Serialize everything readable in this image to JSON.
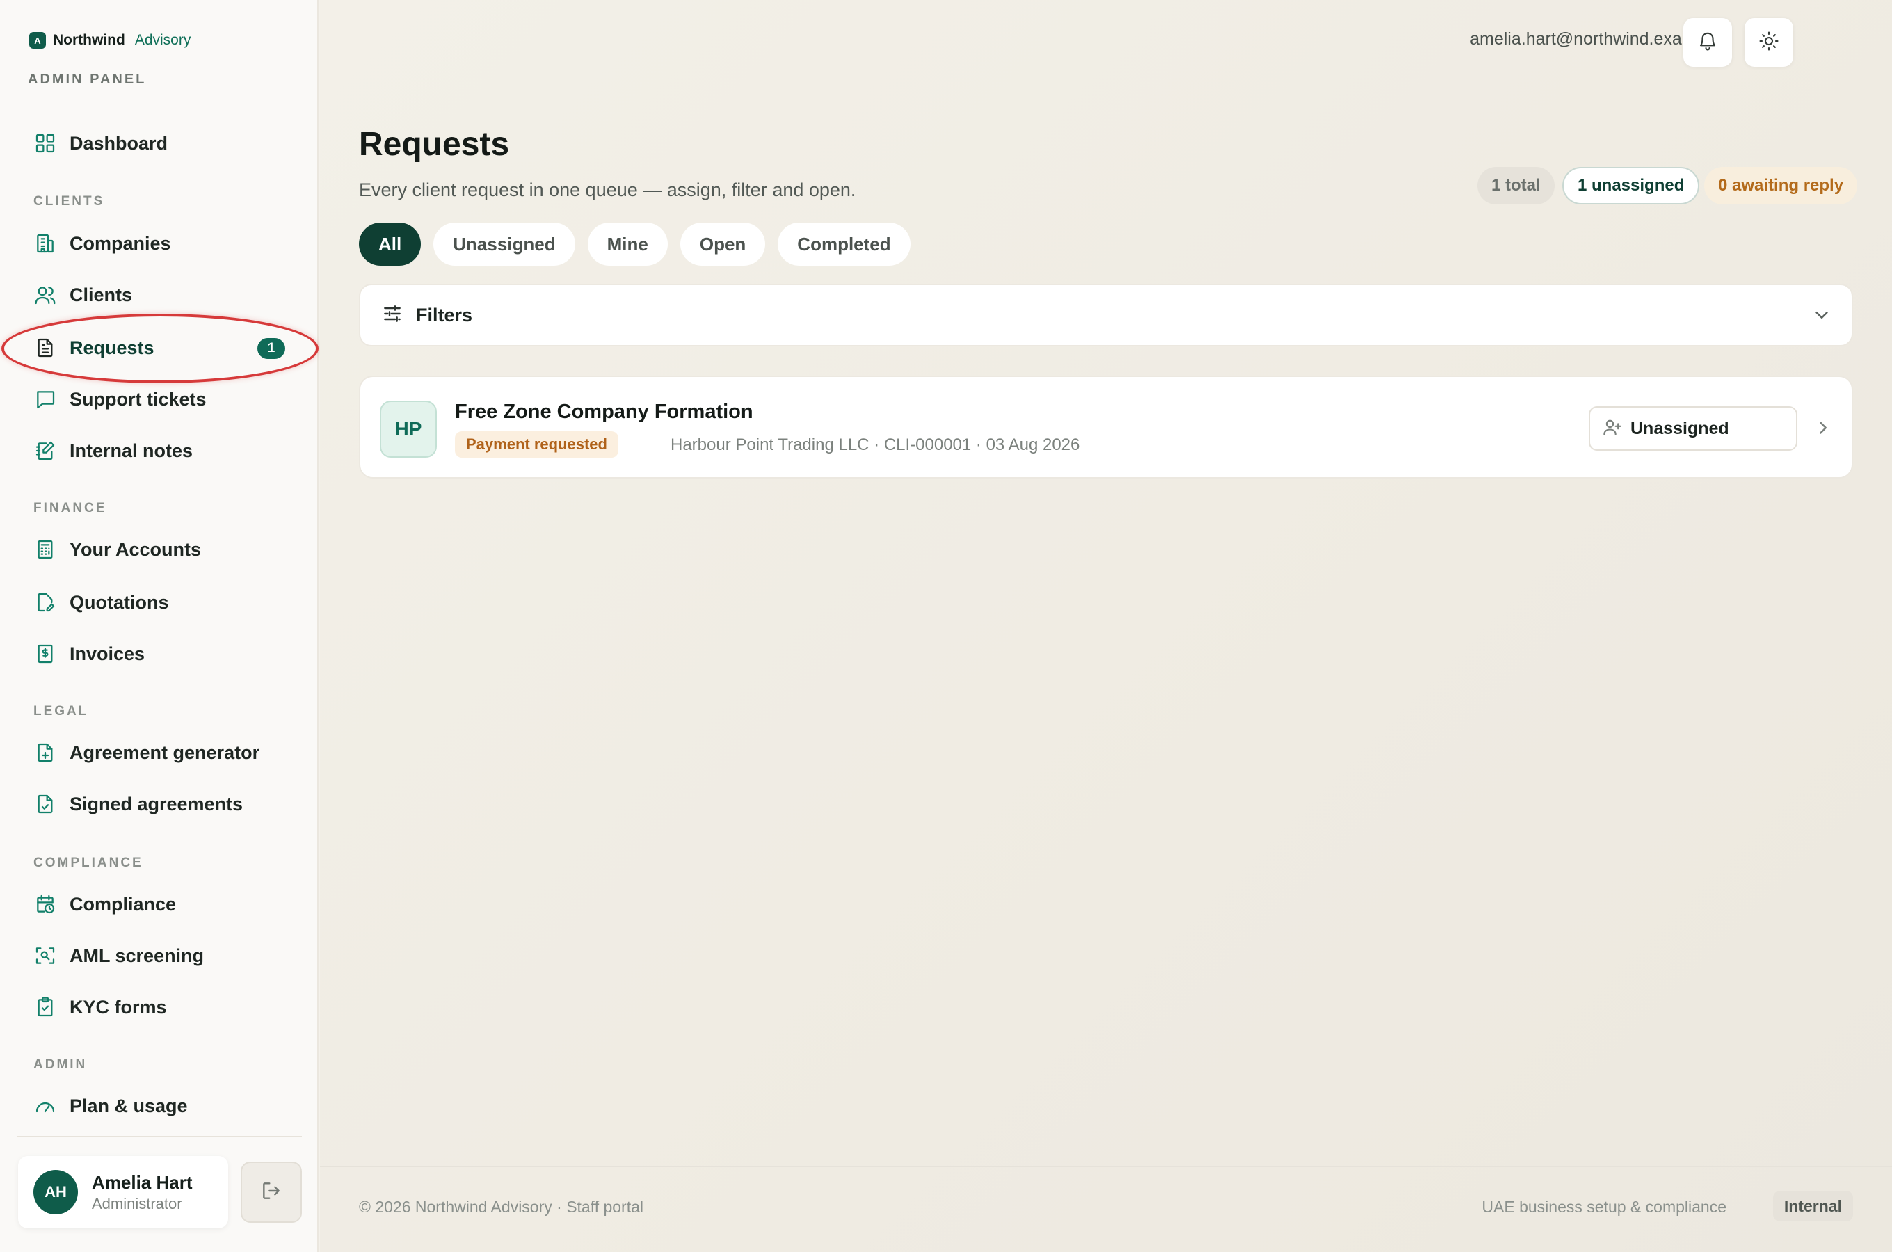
{
  "brand": {
    "logo_letter": "A",
    "name": "Northwind",
    "sub": "Advisory"
  },
  "panel_label": "ADMIN PANEL",
  "nav": {
    "dashboard": "Dashboard",
    "sections": {
      "clients": "CLIENTS",
      "finance": "FINANCE",
      "legal": "LEGAL",
      "compliance": "COMPLIANCE",
      "admin": "ADMIN"
    },
    "items": {
      "companies": "Companies",
      "clients": "Clients",
      "requests": "Requests",
      "requests_badge": "1",
      "support_tickets": "Support tickets",
      "internal_notes": "Internal notes",
      "your_accounts": "Your Accounts",
      "quotations": "Quotations",
      "invoices": "Invoices",
      "agreement_generator": "Agreement generator",
      "signed_agreements": "Signed agreements",
      "compliance": "Compliance",
      "aml_screening": "AML screening",
      "kyc_forms": "KYC forms",
      "plan_usage": "Plan & usage"
    }
  },
  "user": {
    "initials": "AH",
    "name": "Amelia Hart",
    "role": "Administrator"
  },
  "topbar": {
    "email": "amelia.hart@northwind.example"
  },
  "page": {
    "title": "Requests",
    "subtitle": "Every client request in one queue — assign, filter and open."
  },
  "stats": {
    "total": "1 total",
    "unassigned": "1 unassigned",
    "awaiting": "0 awaiting reply"
  },
  "tabs": [
    "All",
    "Unassigned",
    "Mine",
    "Open",
    "Completed"
  ],
  "filters": {
    "label": "Filters"
  },
  "requests": [
    {
      "initials": "HP",
      "title": "Free Zone Company Formation",
      "status": "Payment requested",
      "meta": "Harbour Point Trading LLC · CLI-000001 · 03 Aug 2026",
      "assignee": "Unassigned"
    }
  ],
  "footer": {
    "copyright": "© 2026 Northwind Advisory · Staff portal",
    "tagline": "UAE business setup & compliance",
    "badge": "Internal"
  },
  "colors": {
    "accent": "#0f5c4a",
    "highlight": "#d63a3a",
    "warning": "#b36a1a"
  }
}
